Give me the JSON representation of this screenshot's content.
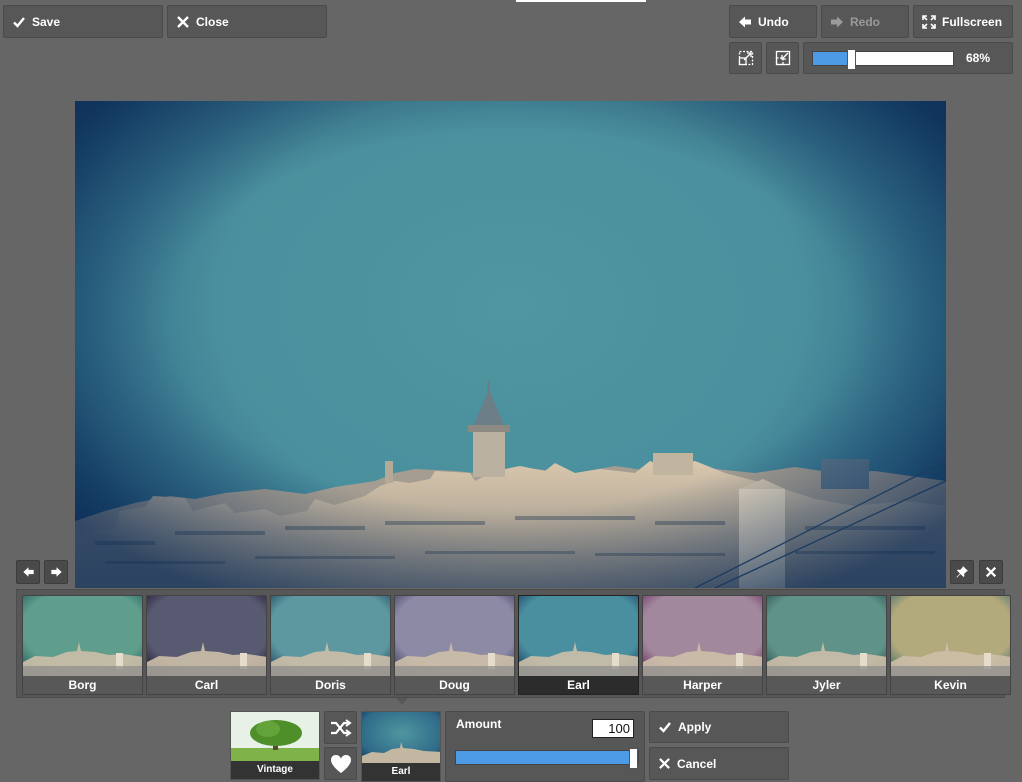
{
  "toolbar": {
    "save_label": "Save",
    "close_label": "Close",
    "undo_label": "Undo",
    "redo_label": "Redo",
    "fullscreen_label": "Fullscreen"
  },
  "zoom": {
    "value_label": "68%",
    "level": 0.28
  },
  "filters": [
    {
      "label": "Borg",
      "tint": "#5f9e8c",
      "vignette": "#1c5a5c"
    },
    {
      "label": "Carl",
      "tint": "#585a72",
      "vignette": "#201630"
    },
    {
      "label": "Doris",
      "tint": "#5d97a0",
      "vignette": "#1c3e5a"
    },
    {
      "label": "Doug",
      "tint": "#8c8aa4",
      "vignette": "#3d3a60"
    },
    {
      "label": "Earl",
      "tint": "#4a8fa0",
      "vignette": "#12385e"
    },
    {
      "label": "Harper",
      "tint": "#a2889c",
      "vignette": "#6a2b63"
    },
    {
      "label": "Jyler",
      "tint": "#5f938a",
      "vignette": "#254a48"
    },
    {
      "label": "Kevin",
      "tint": "#b2a97c",
      "vignette": "#3a6a6a"
    }
  ],
  "selected_filter": "Earl",
  "bottom": {
    "vintage_label": "Vintage",
    "current_filter_label": "Earl",
    "amount_label": "Amount",
    "amount_value": "100",
    "amount_level": 1.0,
    "apply_label": "Apply",
    "cancel_label": "Cancel"
  },
  "colors": {
    "accent": "#4d9be6",
    "panel": "#575757",
    "background": "#666666"
  }
}
